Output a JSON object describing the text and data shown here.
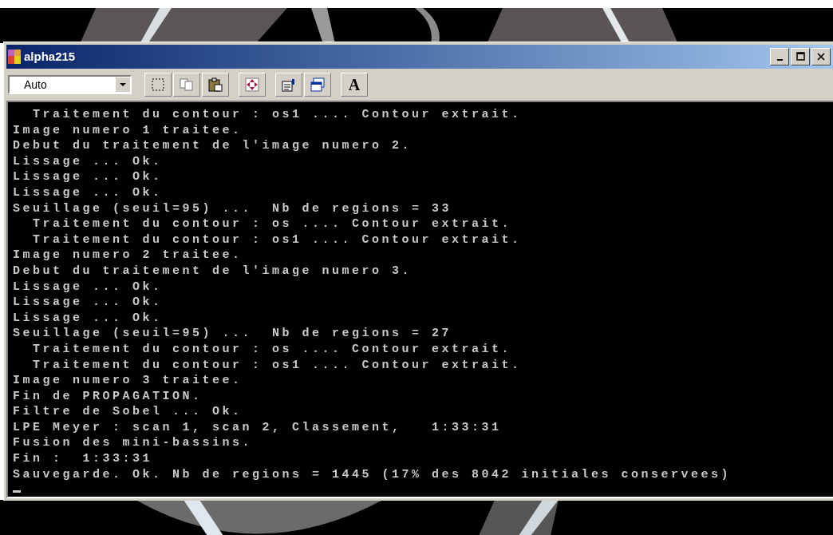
{
  "window": {
    "title": "alpha215"
  },
  "toolbar": {
    "font_size": "Auto",
    "buttons": [
      {
        "kind": "mark"
      },
      {
        "kind": "copy"
      },
      {
        "kind": "paste"
      },
      {
        "kind": "fullscreen"
      },
      {
        "kind": "properties"
      },
      {
        "kind": "background"
      },
      {
        "kind": "font",
        "label": "A"
      }
    ]
  },
  "console": {
    "lines": [
      "  Traitement du contour : os1 .... Contour extrait.",
      "Image numero 1 traitee.",
      "Debut du traitement de l'image numero 2.",
      "Lissage ... Ok.",
      "Lissage ... Ok.",
      "Lissage ... Ok.",
      "Seuillage (seuil=95) ...  Nb de regions = 33",
      "  Traitement du contour : os .... Contour extrait.",
      "  Traitement du contour : os1 .... Contour extrait.",
      "Image numero 2 traitee.",
      "Debut du traitement de l'image numero 3.",
      "Lissage ... Ok.",
      "Lissage ... Ok.",
      "Lissage ... Ok.",
      "Seuillage (seuil=95) ...  Nb de regions = 27",
      "  Traitement du contour : os .... Contour extrait.",
      "  Traitement du contour : os1 .... Contour extrait.",
      "Image numero 3 traitee.",
      "Fin de PROPAGATION.",
      "Filtre de Sobel ... Ok.",
      "LPE Meyer : scan 1, scan 2, Classement,   1:33:31",
      "Fusion des mini-bassins.",
      "Fin :  1:33:31",
      "Sauvegarde. Ok. Nb de regions = 1445 (17% des 8042 initiales conservees)"
    ]
  }
}
